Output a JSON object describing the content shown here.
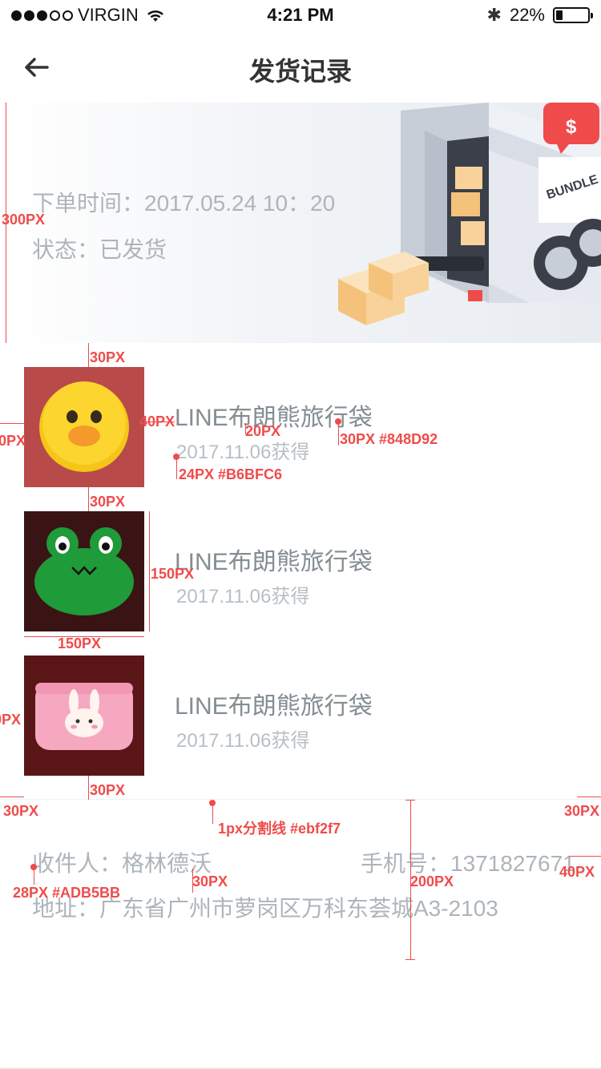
{
  "status_bar": {
    "carrier": "VIRGIN",
    "time": "4:21 PM",
    "battery": "22%",
    "battery_level": 0.22
  },
  "nav": {
    "title": "发货记录"
  },
  "banner": {
    "order_time": "下单时间：2017.05.24 10：20",
    "status": "状态：已发货",
    "truck_label": "BUNDLE",
    "badge_symbol": "$"
  },
  "items": [
    {
      "title": "LINE布朗熊旅行袋",
      "date": "2017.11.06获得",
      "bg": "#B94A4A"
    },
    {
      "title": "LINE布朗熊旅行袋",
      "date": "2017.11.06获得",
      "bg": "#3A1414"
    },
    {
      "title": "LINE布朗熊旅行袋",
      "date": "2017.11.06获得",
      "bg": "#5A1616"
    }
  ],
  "receiver": {
    "name": "收件人：格林德沃",
    "phone": "手机号：1371827671",
    "address": "地址：广东省广州市萝岗区万科东荟城A3-2103"
  },
  "annotations": {
    "banner_height": "300PX",
    "gap_top": "30PX",
    "title_gap": "40PX",
    "left_margin": "30PX",
    "line_gap": "20PX",
    "title_font": "30PX #848D92",
    "date_font": "24PX #B6BFC6",
    "gap_mid": "30PX",
    "thumb_h": "150PX",
    "thumb_w": "150PX",
    "left_margin_3": "30PX",
    "gap_bottom": "30PX",
    "left_margin_bottom": "30PX",
    "divider_note": "1px分割线 #ebf2f7",
    "right_margin": "30PX",
    "recv_font": "28PX #ADB5BB",
    "recv_gap": "30PX",
    "section_height": "200PX",
    "right_margin_recv": "40PX"
  },
  "colors": {
    "title_text": "#848D92",
    "date_text": "#B6BFC6",
    "info_text": "#ADB5BB",
    "divider": "#ebf2f7",
    "annotation": "#f04b4b"
  }
}
